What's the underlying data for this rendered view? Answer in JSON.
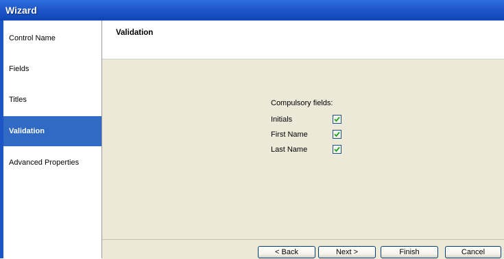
{
  "window": {
    "title": "Wizard"
  },
  "sidebar": {
    "items": [
      {
        "label": "Control Name",
        "active": false
      },
      {
        "label": "Fields",
        "active": false
      },
      {
        "label": "Titles",
        "active": false
      },
      {
        "label": "Validation",
        "active": true
      },
      {
        "label": "Advanced Properties",
        "active": false
      }
    ]
  },
  "header": {
    "title": "Validation"
  },
  "validation": {
    "compulsory_label": "Compulsory fields:",
    "fields": [
      {
        "label": "Initials",
        "checked": true
      },
      {
        "label": "First Name",
        "checked": true
      },
      {
        "label": "Last Name",
        "checked": true
      }
    ]
  },
  "buttons": {
    "back": "< Back",
    "next": "Next >",
    "finish": "Finish",
    "cancel": "Cancel"
  },
  "colors": {
    "titlebar": "#1f57c9",
    "selection": "#316ac5",
    "panel": "#ece9d8",
    "check": "#21a121"
  }
}
